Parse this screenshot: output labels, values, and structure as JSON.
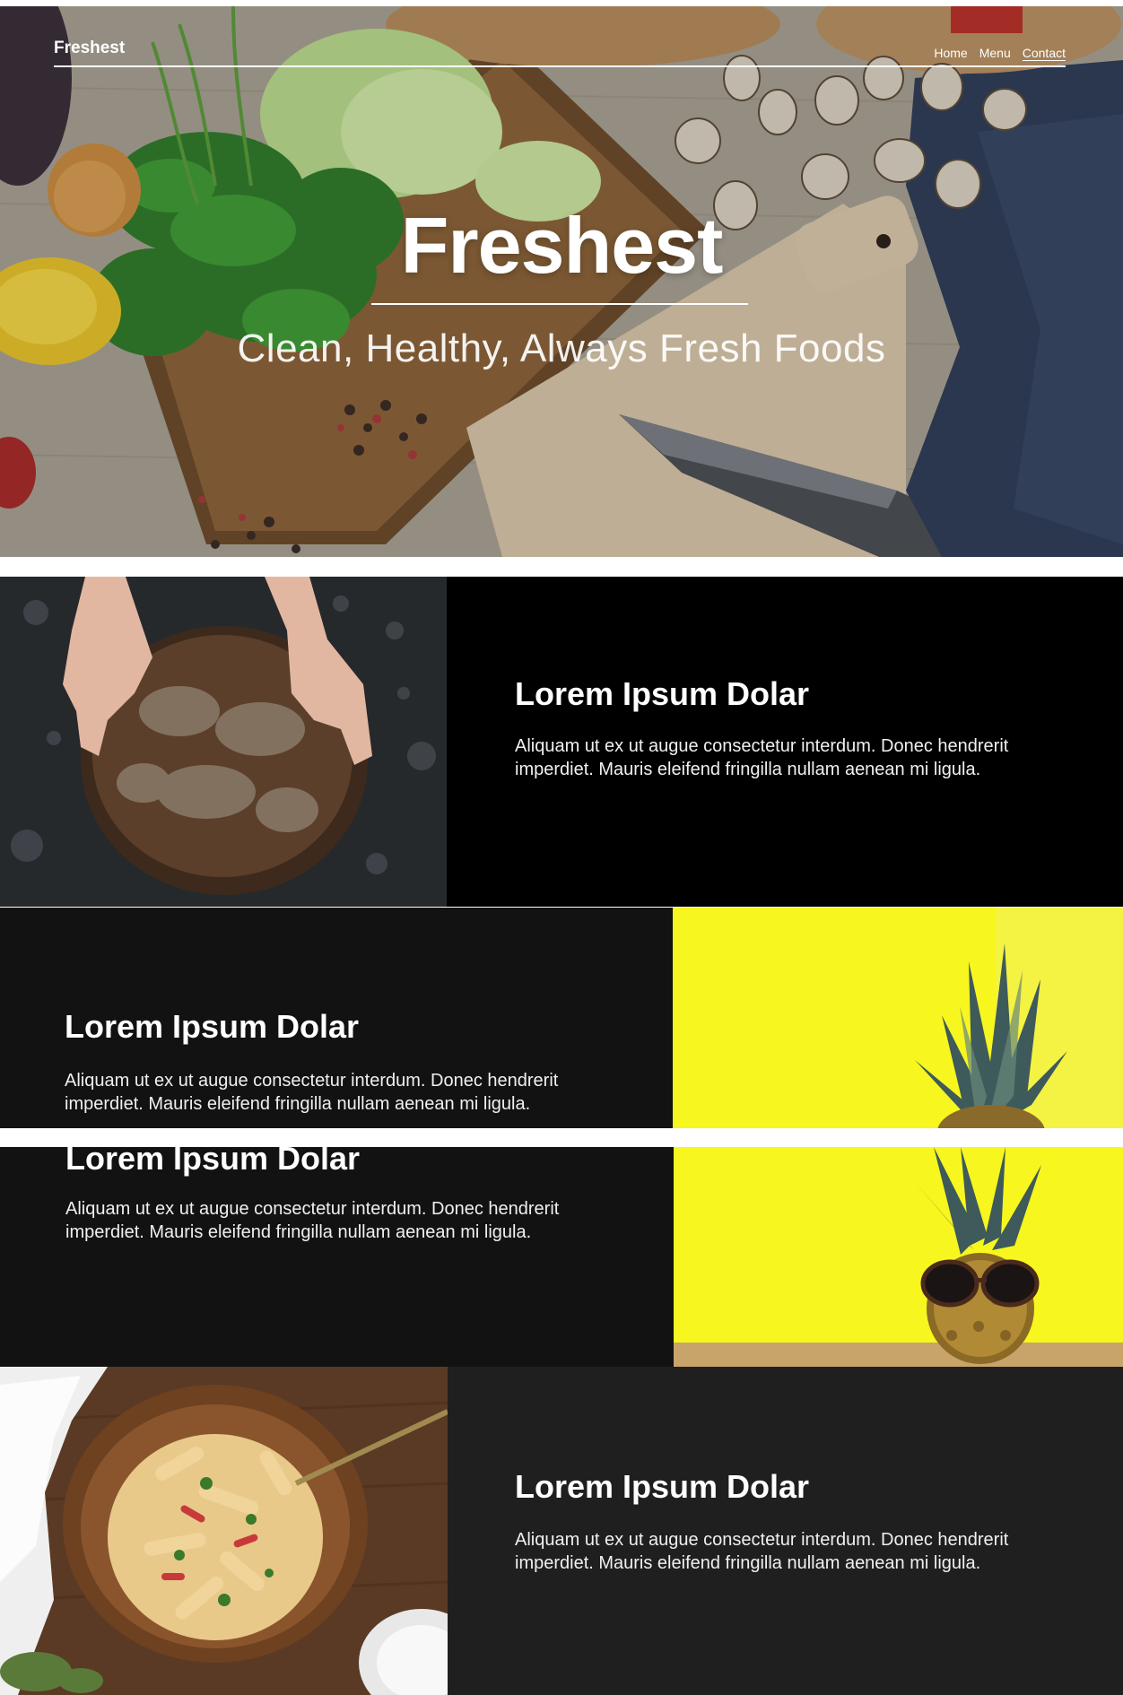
{
  "nav": {
    "brand": "Freshest",
    "links": [
      "Home",
      "Menu",
      "Contact"
    ]
  },
  "hero": {
    "title": "Freshest",
    "subtitle": "Clean, Healthy, Always Fresh Foods"
  },
  "features": [
    {
      "heading": "Lorem Ipsum Dolar",
      "body": "Aliquam ut ex ut augue consectetur interdum. Donec hendrerit imperdiet. Mauris eleifend fringilla nullam aenean mi ligula."
    },
    {
      "heading": "Lorem Ipsum Dolar",
      "body": "Aliquam ut ex ut augue consectetur interdum. Donec hendrerit imperdiet. Mauris eleifend fringilla nullam aenean mi ligula."
    },
    {
      "heading": "Lorem Ipsum Dolar",
      "body": "Aliquam ut ex ut augue consectetur interdum. Donec hendrerit imperdiet. Mauris eleifend fringilla nullam aenean mi ligula."
    },
    {
      "heading": "Lorem Ipsum Dolar",
      "body": "Aliquam ut ex ut augue consectetur interdum. Donec hendrerit imperdiet. Mauris eleifend fringilla nullam aenean mi ligula."
    }
  ],
  "colors": {
    "accent_yellow": "#f7f61e",
    "panel_black": "#000000",
    "panel_dark": "#121212",
    "panel_charcoal": "#1f1f1f"
  },
  "images": [
    "kitchen-counter-vegetables-image",
    "bread-loaf-image",
    "pineapple-image",
    "pineapple-sunglasses-image",
    "pasta-bowl-image"
  ]
}
